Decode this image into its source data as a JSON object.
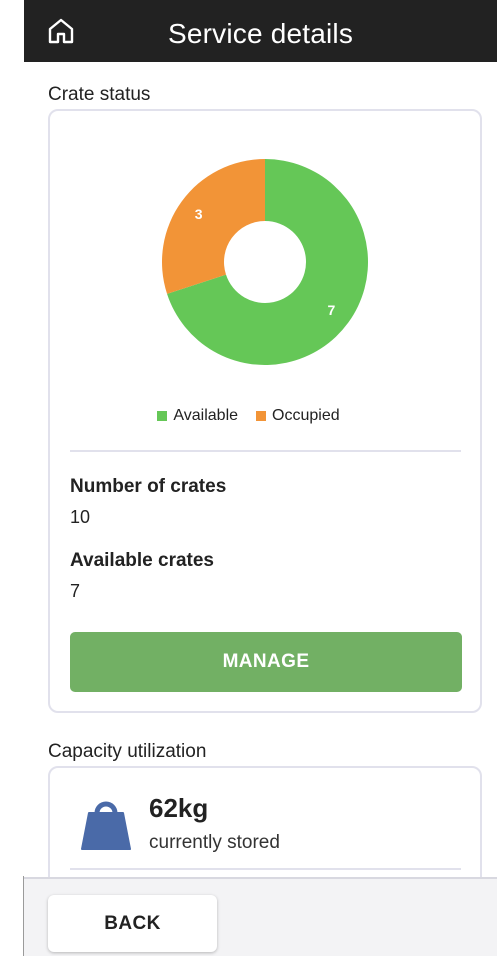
{
  "header": {
    "title": "Service details",
    "home_icon": "home-icon"
  },
  "crate_status": {
    "section_label": "Crate status",
    "number_of_crates_label": "Number of crates",
    "number_of_crates_value": "10",
    "available_crates_label": "Available crates",
    "available_crates_value": "7",
    "manage_label": "MANAGE"
  },
  "chart_data": {
    "type": "pie",
    "categories": [
      "Available",
      "Occupied"
    ],
    "values": [
      7,
      3
    ],
    "colors": [
      "#65c757",
      "#f29437"
    ],
    "legend": "bottom"
  },
  "capacity": {
    "section_label": "Capacity utilization",
    "value": "62kg",
    "subtitle": "currently stored",
    "icon": "weight-icon"
  },
  "footer": {
    "back_label": "BACK"
  },
  "colors": {
    "header_bg": "#222222",
    "accent_green": "#72b064",
    "icon_blue": "#4a6aa8"
  }
}
